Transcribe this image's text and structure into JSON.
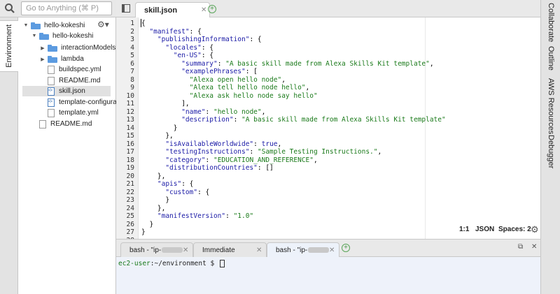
{
  "search": {
    "placeholder": "Go to Anything (⌘ P)"
  },
  "left_rail": {
    "environment_label": "Environment"
  },
  "file_tree": {
    "items": [
      {
        "label": "hello-kokeshi",
        "kind": "folder",
        "expanded": true
      },
      {
        "label": "hello-kokeshi",
        "kind": "folder",
        "expanded": true
      },
      {
        "label": "interactionModels",
        "kind": "folder",
        "expanded": false
      },
      {
        "label": "lambda",
        "kind": "folder",
        "expanded": false
      },
      {
        "label": "buildspec.yml",
        "kind": "file"
      },
      {
        "label": "README.md",
        "kind": "file"
      },
      {
        "label": "skill.json",
        "kind": "json",
        "selected": true
      },
      {
        "label": "template-configuration",
        "kind": "json"
      },
      {
        "label": "template.yml",
        "kind": "file"
      },
      {
        "label": "README.md",
        "kind": "file"
      }
    ]
  },
  "editor": {
    "active_tab": "skill.json",
    "lines": [
      "{",
      "  \"manifest\": {",
      "    \"publishingInformation\": {",
      "      \"locales\": {",
      "        \"en-US\": {",
      "          \"summary\": \"A basic skill made from Alexa Skills Kit template\",",
      "          \"examplePhrases\": [",
      "            \"Alexa open hello node\",",
      "            \"Alexa tell hello node hello\",",
      "            \"Alexa ask hello node say hello\"",
      "          ],",
      "          \"name\": \"hello node\",",
      "          \"description\": \"A basic skill made from Alexa Skills Kit template\"",
      "        }",
      "      },",
      "      \"isAvailableWorldwide\": true,",
      "      \"testingInstructions\": \"Sample Testing Instructions.\",",
      "      \"category\": \"EDUCATION_AND_REFERENCE\",",
      "      \"distributionCountries\": []",
      "    },",
      "    \"apis\": {",
      "      \"custom\": {",
      "      }",
      "    },",
      "    \"manifestVersion\": \"1.0\"",
      "  }",
      "}",
      ""
    ],
    "status": {
      "position": "1:1",
      "mode": "JSON",
      "spaces": "Spaces: 2"
    }
  },
  "right_rail": {
    "tabs": [
      "Collaborate",
      "Outline",
      "AWS Resources",
      "Debugger"
    ]
  },
  "terminal": {
    "tabs": [
      {
        "label": "bash - \"ip-",
        "blurred": true
      },
      {
        "label": "Immediate",
        "blurred": false
      },
      {
        "label": "bash - \"ip-",
        "blurred": true,
        "active": true
      }
    ],
    "prompt_user": "ec2-user",
    "prompt_dir": ":~/environment $ "
  },
  "colors": {
    "key": "#1a1aa6",
    "string": "#1a7a1a",
    "folder": "#5c9be0",
    "terminal_bg": "#eef2fa"
  },
  "icons": [
    "search-icon",
    "gear-icon",
    "folder-icon",
    "file-icon",
    "json-file-icon",
    "add-tab-icon",
    "close-icon",
    "maximize-icon"
  ]
}
